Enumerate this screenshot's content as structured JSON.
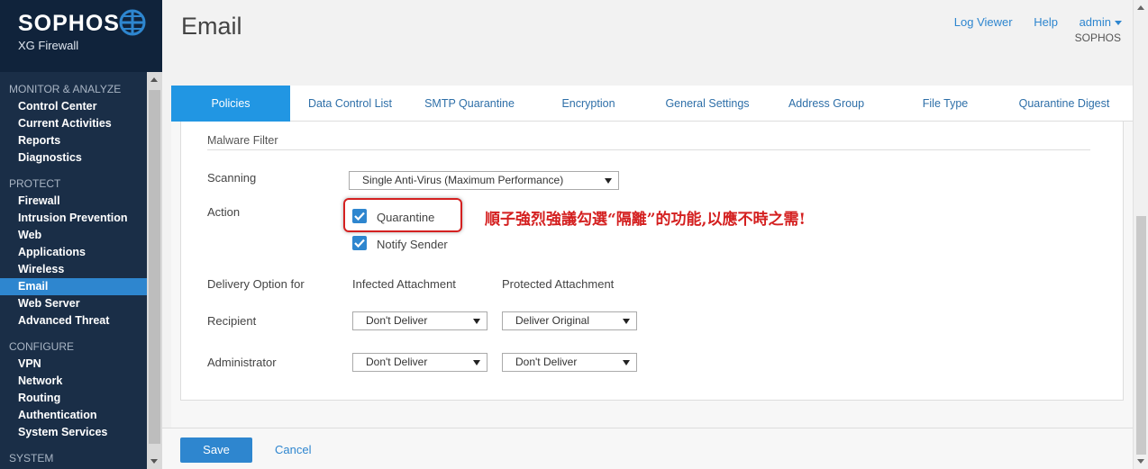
{
  "brand": {
    "name": "SOPHOS",
    "product": "XG Firewall",
    "logo_icon": "globe-logo-icon"
  },
  "sidebar": {
    "groups": [
      {
        "title": "MONITOR & ANALYZE",
        "items": [
          "Control Center",
          "Current Activities",
          "Reports",
          "Diagnostics"
        ]
      },
      {
        "title": "PROTECT",
        "items": [
          "Firewall",
          "Intrusion Prevention",
          "Web",
          "Applications",
          "Wireless",
          "Email",
          "Web Server",
          "Advanced Threat"
        ]
      },
      {
        "title": "CONFIGURE",
        "items": [
          "VPN",
          "Network",
          "Routing",
          "Authentication",
          "System Services"
        ]
      },
      {
        "title": "SYSTEM",
        "items": []
      }
    ],
    "active_item": "Email"
  },
  "header": {
    "title": "Email",
    "log_viewer": "Log Viewer",
    "help": "Help",
    "user": "admin",
    "org": "SOPHOS"
  },
  "tabs": [
    {
      "label": "Policies",
      "active": true
    },
    {
      "label": "Data Control List",
      "active": false
    },
    {
      "label": "SMTP Quarantine",
      "active": false
    },
    {
      "label": "Encryption",
      "active": false
    },
    {
      "label": "General Settings",
      "active": false
    },
    {
      "label": "Address Group",
      "active": false
    },
    {
      "label": "File Type",
      "active": false
    },
    {
      "label": "Quarantine Digest",
      "active": false
    }
  ],
  "malware_filter": {
    "section_title": "Malware Filter",
    "scanning_label": "Scanning",
    "scanning_value": "Single Anti-Virus (Maximum Performance)",
    "action_label": "Action",
    "quarantine_label": "Quarantine",
    "quarantine_checked": true,
    "notify_label": "Notify Sender",
    "notify_checked": true,
    "annotation": "順子強烈強議勾選“隔離”的功能,以應不時之需!",
    "delivery_label": "Delivery Option for",
    "infected_header": "Infected Attachment",
    "protected_header": "Protected Attachment",
    "recipient_label": "Recipient",
    "recipient_infected": "Don't Deliver",
    "recipient_protected": "Deliver Original",
    "admin_label": "Administrator",
    "admin_infected": "Don't Deliver",
    "admin_protected": "Don't Deliver"
  },
  "footer": {
    "save": "Save",
    "cancel": "Cancel"
  },
  "colors": {
    "sidebar_bg": "#1a2e47",
    "accent": "#2e86cf",
    "tab_active": "#2196e3",
    "annotation_red": "#d42020"
  }
}
